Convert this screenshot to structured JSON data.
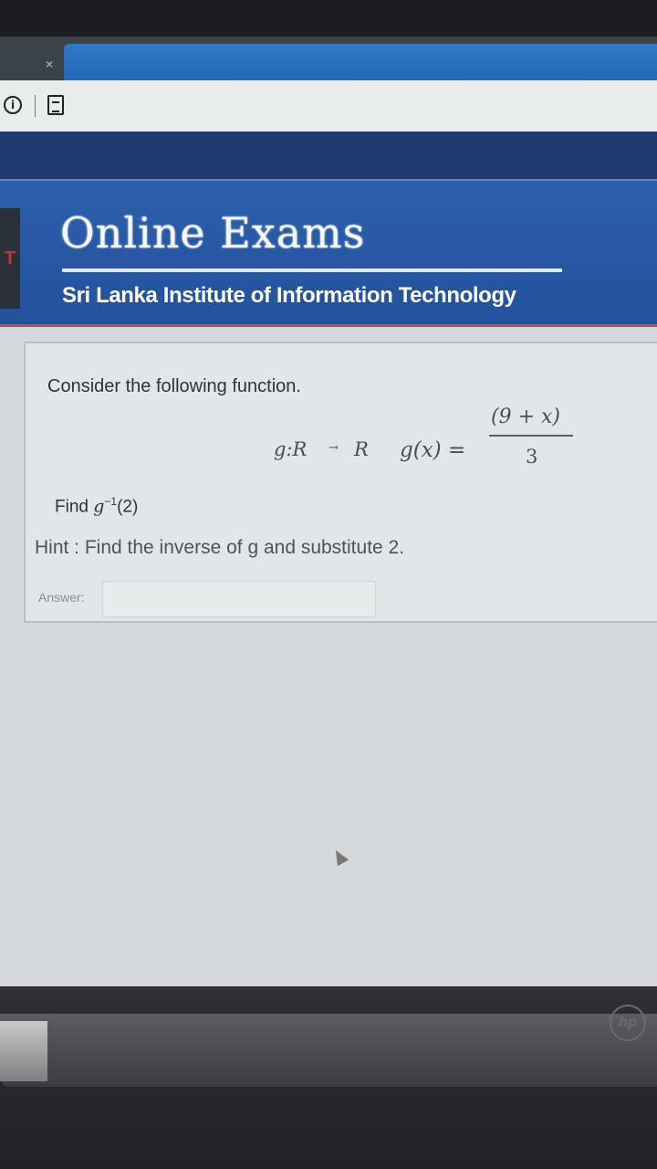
{
  "browser": {
    "tab_close": "×",
    "logo_letter": "T"
  },
  "site": {
    "title": "Online Exams",
    "subtitle": "Sri Lanka Institute of Information Technology"
  },
  "question": {
    "prompt": "Consider the following function.",
    "formula": {
      "domain": "g:R",
      "arrow": "→",
      "codomain": "R",
      "lhs": "g(x) =",
      "numerator": "(9 + x)",
      "denominator": "3"
    },
    "find": {
      "prefix": "Find",
      "func": "g",
      "exponent": "−1",
      "argument": "(2)"
    },
    "hint": "Hint : Find the inverse of g and substitute 2.",
    "answer_label": "Answer:",
    "answer_value": ""
  },
  "device": {
    "brand": "hp"
  }
}
